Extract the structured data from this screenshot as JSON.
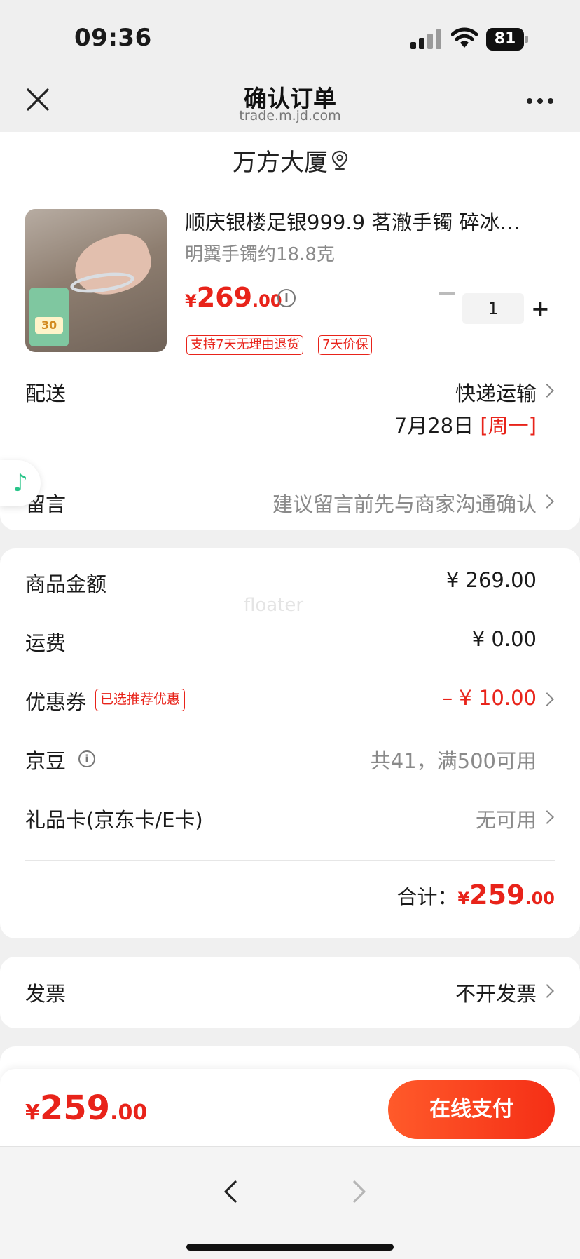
{
  "status_bar": {
    "time": "09:36",
    "battery": "81"
  },
  "nav": {
    "title": "确认订单",
    "subtitle": "trade.m.jd.com"
  },
  "address": {
    "text": "万方大厦"
  },
  "product": {
    "title": "顺庆银楼足银999.9 茗澈手镯 碎冰…",
    "spec": "明翼手镯约18.8克",
    "price_currency": "¥",
    "price_int": "269",
    "price_dec": ".00",
    "sticker_text": "30",
    "quantity": "1",
    "tags": [
      "支持7天无理由退货",
      "7天价保"
    ]
  },
  "delivery": {
    "label": "配送",
    "method": "快递运输",
    "date": "7月28日",
    "weekday": "[周一]"
  },
  "message": {
    "label": "留言",
    "placeholder": "建议留言前先与商家沟通确认"
  },
  "summary": {
    "watermark": "floater",
    "goods_label": "商品金额",
    "goods_value": "¥ 269.00",
    "shipping_label": "运费",
    "shipping_value": "¥ 0.00",
    "coupon_label": "优惠券",
    "coupon_tag": "已选推荐优惠",
    "coupon_value": "– ¥ 10.00",
    "jingdou_label": "京豆",
    "jingdou_value": "共41，满500可用",
    "giftcard_label": "礼品卡(京东卡/E卡)",
    "giftcard_value": "无可用",
    "total_label": "合计：",
    "total_currency": "¥",
    "total_int": "259",
    "total_dec": ".00"
  },
  "invoice": {
    "label": "发票",
    "value": "不开发票"
  },
  "pay_bar": {
    "currency": "¥",
    "int": "259",
    "dec": ".00",
    "button": "在线支付"
  },
  "colors": {
    "accent": "#e8231a",
    "pay_gradient_start": "#ff5a2a",
    "pay_gradient_end": "#f52f16",
    "music_icon": "#28c489"
  },
  "icons": [
    "close-icon",
    "more-icon",
    "location-pin-icon",
    "info-icon",
    "chevron-right-icon",
    "music-note-icon",
    "back-arrow-icon",
    "forward-arrow-icon"
  ]
}
